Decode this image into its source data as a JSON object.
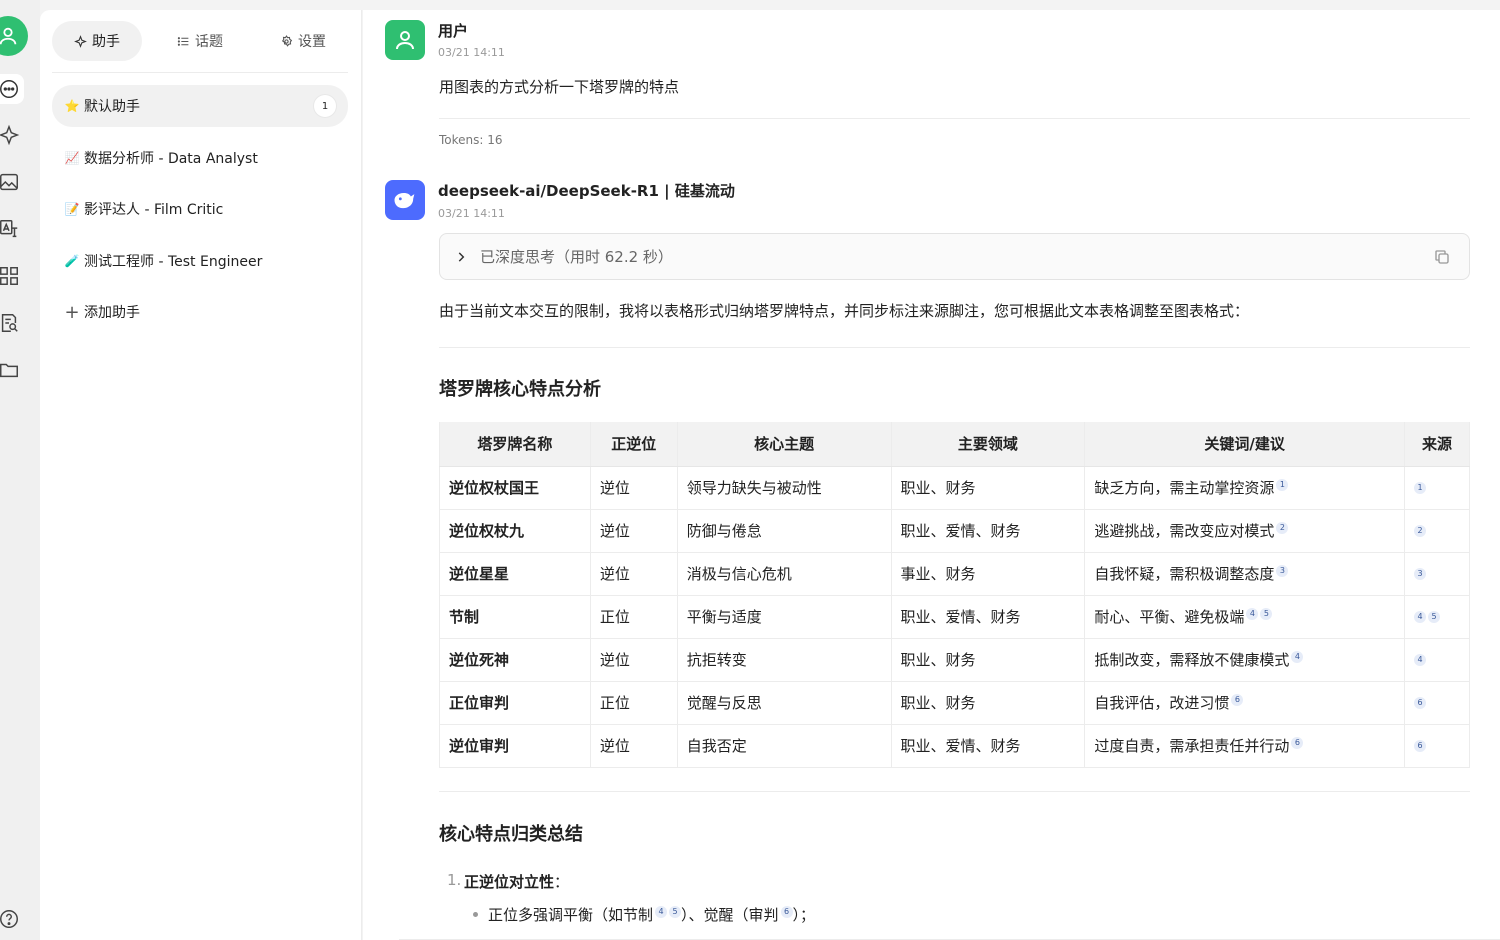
{
  "sidebar_tabs": [
    {
      "label": "助手",
      "icon": "sparkle-icon"
    },
    {
      "label": "话题",
      "icon": "list-icon"
    },
    {
      "label": "设置",
      "icon": "gear-icon"
    }
  ],
  "assistants": [
    {
      "emoji": "⭐",
      "label": "默认助手",
      "count": "1"
    },
    {
      "emoji": "📈",
      "label": "数据分析师 - Data Analyst"
    },
    {
      "emoji": "📝",
      "label": "影评达人 - Film Critic"
    },
    {
      "emoji": "🧪",
      "label": "测试工程师 - Test Engineer"
    }
  ],
  "add_assistant": "添加助手",
  "user_message": {
    "sender": "用户",
    "time": "03/21 14:11",
    "text": "用图表的方式分析一下塔罗牌的特点",
    "tokens": "Tokens: 16"
  },
  "ai_message": {
    "sender": "deepseek-ai/DeepSeek-R1 | 硅基流动",
    "time": "03/21 14:11",
    "thinking": "已深度思考（用时 62.2 秒）",
    "intro": "由于当前文本交互的限制，我将以表格形式归纳塔罗牌特点，并同步标注来源脚注，您可根据此文本表格调整至图表格式："
  },
  "table_heading": "塔罗牌核心特点分析",
  "table": {
    "headers": [
      "塔罗牌名称",
      "正逆位",
      "核心主题",
      "主要领域",
      "关键词/建议",
      "来源"
    ],
    "rows": [
      {
        "name": "逆位权杖国王",
        "pos": "逆位",
        "theme": "领导力缺失与被动性",
        "area": "职业、财务",
        "kw": "缺乏方向，需主动掌控资源",
        "fn": [
          "1"
        ]
      },
      {
        "name": "逆位权杖九",
        "pos": "逆位",
        "theme": "防御与倦怠",
        "area": "职业、爱情、财务",
        "kw": "逃避挑战，需改变应对模式",
        "fn": [
          "2"
        ]
      },
      {
        "name": "逆位星星",
        "pos": "逆位",
        "theme": "消极与信心危机",
        "area": "事业、财务",
        "kw": "自我怀疑，需积极调整态度",
        "fn": [
          "3"
        ]
      },
      {
        "name": "节制",
        "pos": "正位",
        "theme": "平衡与适度",
        "area": "职业、爱情、财务",
        "kw": "耐心、平衡、避免极端",
        "fn": [
          "4",
          "5"
        ]
      },
      {
        "name": "逆位死神",
        "pos": "逆位",
        "theme": "抗拒转变",
        "area": "职业、财务",
        "kw": "抵制改变，需释放不健康模式",
        "fn": [
          "4"
        ]
      },
      {
        "name": "正位审判",
        "pos": "正位",
        "theme": "觉醒与反思",
        "area": "职业、财务",
        "kw": "自我评估，改进习惯",
        "fn": [
          "6"
        ]
      },
      {
        "name": "逆位审判",
        "pos": "逆位",
        "theme": "自我否定",
        "area": "职业、爱情、财务",
        "kw": "过度自责，需承担责任并行动",
        "fn": [
          "6"
        ]
      }
    ]
  },
  "summary_heading": "核心特点归类总结",
  "summary": {
    "item1_num": "1.",
    "item1_title": "正逆位对立性",
    "item1_colon": "：",
    "bullet1_a": "正位多强调平衡（如节制",
    "bullet1_fn1": "4",
    "bullet1_fn2": "5",
    "bullet1_b": "）、觉醒（审判",
    "bullet1_fn3": "6",
    "bullet1_c": "）；"
  },
  "colors": {
    "user_avatar": "#2fbf71",
    "ai_avatar": "#4d6bfe",
    "footnote_bg": "#e6ecf8"
  }
}
